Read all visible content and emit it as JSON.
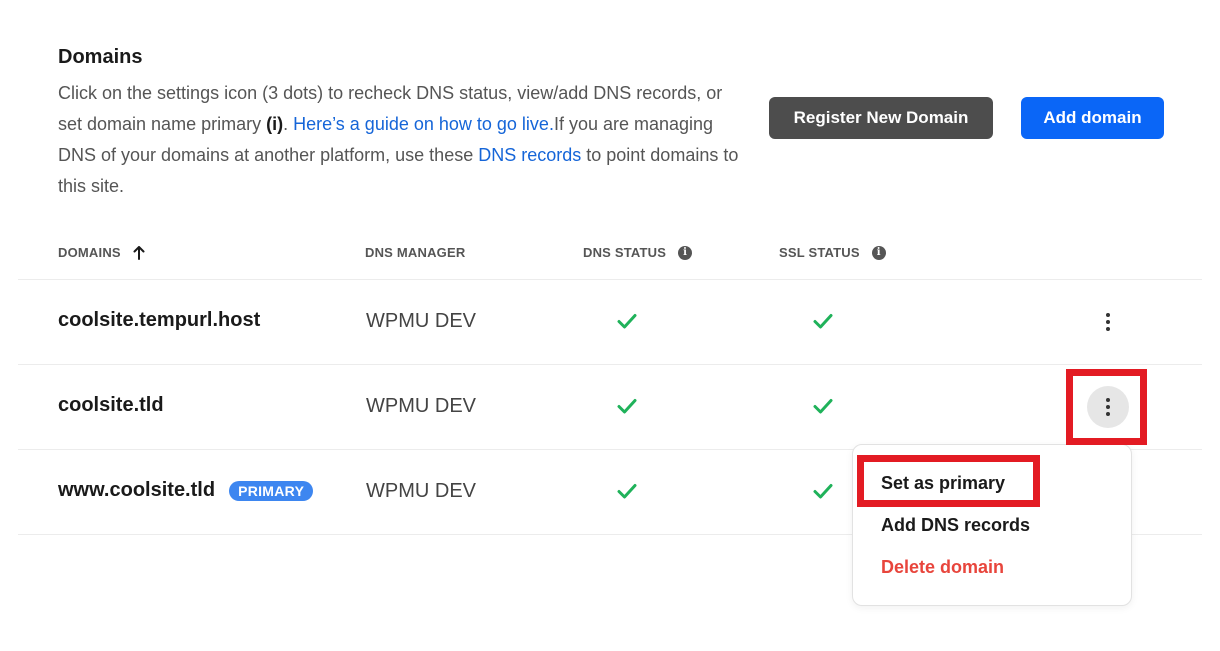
{
  "header": {
    "title": "Domains",
    "desc_part1": "Click on the settings icon (3 dots) to recheck DNS status, view/add DNS records, or set domain name primary ",
    "desc_bold": "(i)",
    "desc_part2": ". ",
    "guide_link": "Here’s a guide on how to go live.",
    "desc_part3": "If you are managing DNS of your domains at another platform, use these ",
    "dns_link": "DNS records",
    "desc_part4": " to point domains to this site."
  },
  "buttons": {
    "register": "Register New Domain",
    "add": "Add domain"
  },
  "table": {
    "columns": {
      "domains": "DOMAINS",
      "dns_manager": "DNS MANAGER",
      "dns_status": "DNS STATUS",
      "ssl_status": "SSL STATUS"
    },
    "rows": [
      {
        "domain": "coolsite.tempurl.host",
        "badge": "",
        "manager": "WPMU DEV",
        "dns_ok": true,
        "ssl_ok": true
      },
      {
        "domain": "coolsite.tld",
        "badge": "",
        "manager": "WPMU DEV",
        "dns_ok": true,
        "ssl_ok": true
      },
      {
        "domain": "www.coolsite.tld",
        "badge": "PRIMARY",
        "manager": "WPMU DEV",
        "dns_ok": true,
        "ssl_ok": true
      }
    ]
  },
  "menu": {
    "set_primary": "Set as primary",
    "add_dns": "Add DNS records",
    "delete": "Delete domain"
  },
  "icons": {
    "sort": "arrow-up-icon",
    "info": "info-icon",
    "check": "check-icon",
    "kebab": "kebab-menu-icon"
  },
  "colors": {
    "primary_blue": "#0a66f7",
    "badge_blue": "#3d86f0",
    "link_blue": "#1565d8",
    "check_green": "#1fb25a",
    "danger_red": "#e8453c",
    "highlight_red": "#e31b23",
    "dark_button": "#4d4d4d"
  }
}
